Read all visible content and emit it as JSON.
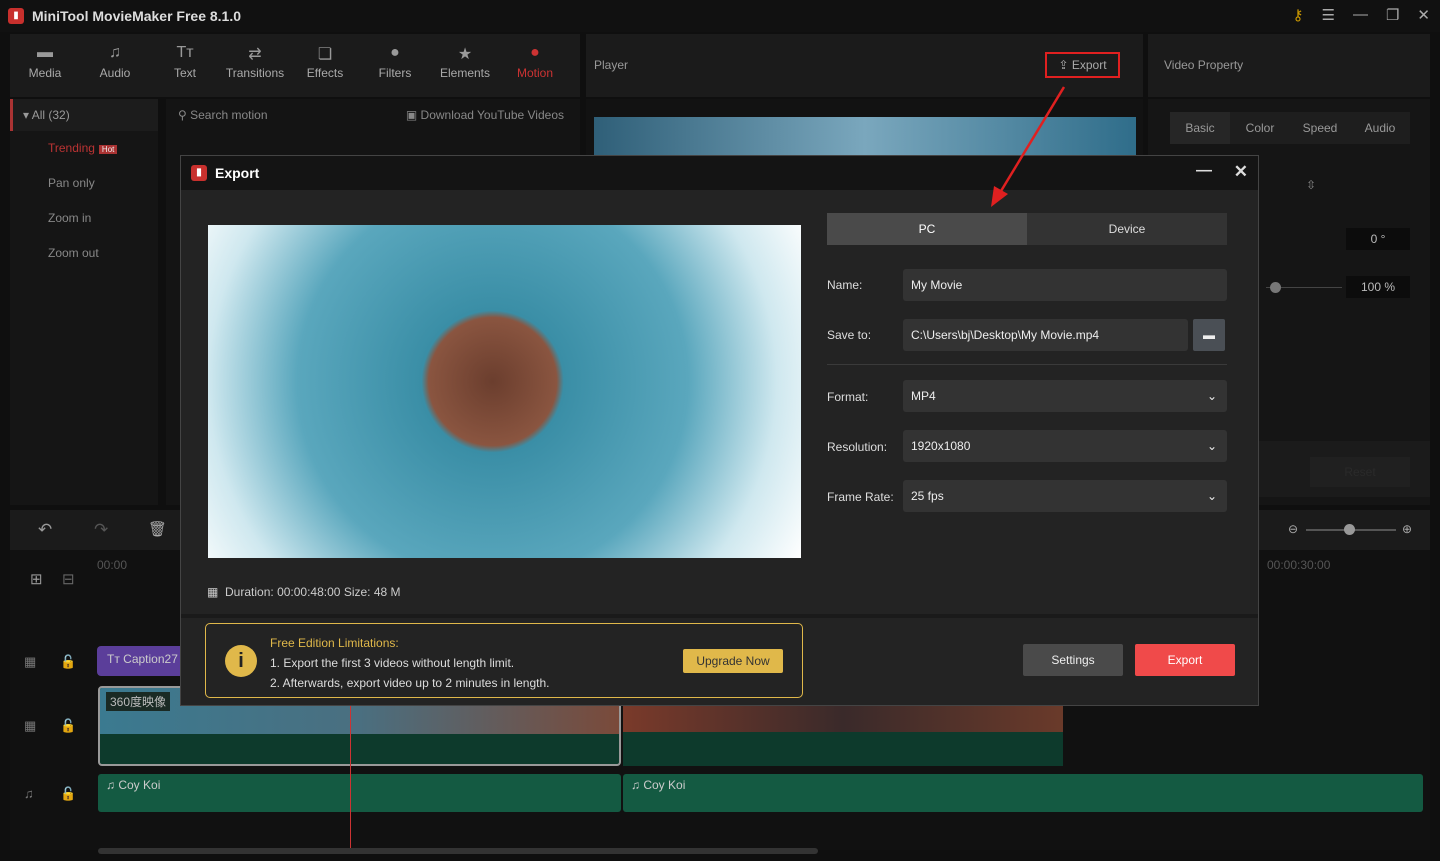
{
  "app": {
    "title": "MiniTool MovieMaker Free 8.1.0"
  },
  "toolbar": {
    "items": [
      {
        "label": "Media",
        "icon": "folder-icon"
      },
      {
        "label": "Audio",
        "icon": "music-icon"
      },
      {
        "label": "Text",
        "icon": "text-icon"
      },
      {
        "label": "Transitions",
        "icon": "transitions-icon"
      },
      {
        "label": "Effects",
        "icon": "effects-icon"
      },
      {
        "label": "Filters",
        "icon": "filters-icon"
      },
      {
        "label": "Elements",
        "icon": "elements-icon"
      },
      {
        "label": "Motion",
        "icon": "motion-icon",
        "active": true
      }
    ]
  },
  "sidebar": {
    "all": "All (32)",
    "items": [
      {
        "label": "Trending",
        "badge": "Hot"
      },
      {
        "label": "Pan only"
      },
      {
        "label": "Zoom in"
      },
      {
        "label": "Zoom out"
      }
    ]
  },
  "library": {
    "search_placeholder": "Search motion",
    "download": "Download YouTube Videos"
  },
  "player": {
    "title": "Player",
    "export": "Export"
  },
  "property": {
    "title": "Video Property",
    "tabs": [
      "Basic",
      "Color",
      "Speed",
      "Audio"
    ],
    "rotation": "0 °",
    "scale": "100 %",
    "reset": "Reset"
  },
  "timeline": {
    "start": "00:00",
    "mark": "00:00:30:00",
    "caption": "Caption27",
    "video_clip": "360度映像",
    "audio_clips": [
      "Coy Koi",
      "Coy Koi"
    ]
  },
  "export_dialog": {
    "title": "Export",
    "tabs": [
      "PC",
      "Device"
    ],
    "active_tab": "PC",
    "name_label": "Name:",
    "name": "My Movie",
    "save_label": "Save to:",
    "save_path": "C:\\Users\\bj\\Desktop\\My Movie.mp4",
    "format_label": "Format:",
    "format": "MP4",
    "resolution_label": "Resolution:",
    "resolution": "1920x1080",
    "framerate_label": "Frame Rate:",
    "framerate": "25 fps",
    "duration_label": "Duration:",
    "duration": "00:00:48:00",
    "size_label": "Size:",
    "size": "48 M",
    "limits_title": "Free Edition Limitations:",
    "limit1": "1. Export the first 3 videos without length limit.",
    "limit2": "2. Afterwards, export video up to 2 minutes in length.",
    "upgrade": "Upgrade Now",
    "settings": "Settings",
    "export": "Export"
  },
  "colors": {
    "accent": "#f04a4a",
    "warning": "#e0b84a",
    "highlight_box": "#e02020"
  }
}
